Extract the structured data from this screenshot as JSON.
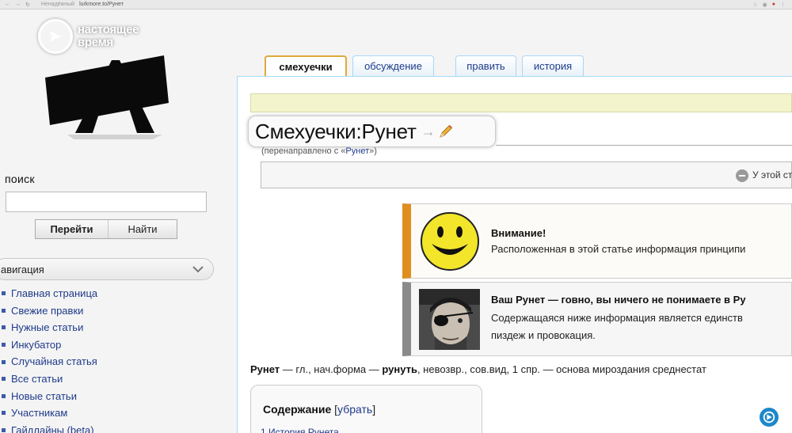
{
  "browser": {
    "insecure_label": "Ненадёжный",
    "url": "lurkmore.to/Рунет"
  },
  "watermark": {
    "line1": "настоящее",
    "line2": "время"
  },
  "sidebar": {
    "search_label": "поиск",
    "search_value": "",
    "go_button": "Перейти",
    "find_button": "Найти",
    "nav_header": "авигация",
    "items": [
      {
        "label": "Главная страница"
      },
      {
        "label": "Свежие правки"
      },
      {
        "label": "Нужные статьи"
      },
      {
        "label": "Инкубатор"
      },
      {
        "label": "Случайная статья"
      },
      {
        "label": "Все статьи"
      },
      {
        "label": "Новые статьи"
      },
      {
        "label": "Участникам"
      },
      {
        "label": "Гайдлайны (beta)"
      }
    ]
  },
  "tabs": {
    "article": "смехуечки",
    "discussion": "обсуждение",
    "edit": "править",
    "history": "история"
  },
  "page": {
    "title": "Смехуечки:Рунет",
    "redirect_prefix": "(перенаправлено с «",
    "redirect_link": "Рунет",
    "redirect_suffix": "»)",
    "meta_text": "У этой ст"
  },
  "notices": {
    "warning_title": "Внимание!",
    "warning_text": "Расположенная в этой статье информация принципи",
    "runet_title": "Ваш Рунет — говно, вы ничего не понимаете в Ру",
    "runet_text_1": "Содержащаяся ниже информация является единств",
    "runet_text_2": "пиздеж и провокация."
  },
  "article": {
    "term": "Рунет",
    "def_part1": " — гл., нач.форма — ",
    "term2": "рунуть",
    "def_part2": ", невозвр., сов.вид, 1 спр. — основа мироздания среднестат"
  },
  "toc": {
    "title": "Содержание",
    "hide_open": " [",
    "hide_link": "убрать",
    "hide_close": "]",
    "first_item": "1 История Рунета"
  },
  "colors": {
    "link": "#1f3b8a",
    "tab_border": "#a7d7f9",
    "active_tab_border": "#e0a93b",
    "warning_stripe": "#e08e1e",
    "notice_bg": "#f3f4cc",
    "smiley": "#f2e52a"
  }
}
